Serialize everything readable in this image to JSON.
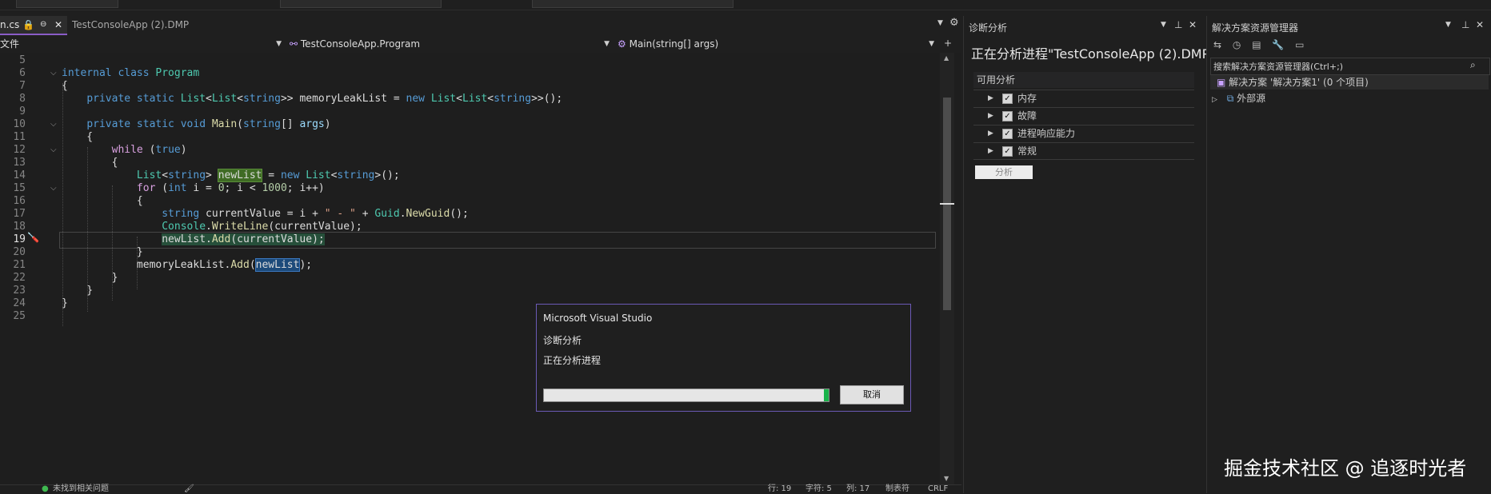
{
  "toolbar": {},
  "tabs": [
    {
      "label": "n.cs",
      "pin": "⊖",
      "close": "✕",
      "active": true
    },
    {
      "label": "TestConsoleApp (2).DMP",
      "active": false
    }
  ],
  "navbar": {
    "file_dropdown": "文件",
    "class_dropdown": "TestConsoleApp.Program",
    "member_dropdown": "Main(string[] args)"
  },
  "editor": {
    "lines": [
      {
        "n": "5"
      },
      {
        "n": "6"
      },
      {
        "n": "7"
      },
      {
        "n": "8"
      },
      {
        "n": "9"
      },
      {
        "n": "10"
      },
      {
        "n": "11"
      },
      {
        "n": "12"
      },
      {
        "n": "13"
      },
      {
        "n": "14"
      },
      {
        "n": "15"
      },
      {
        "n": "16"
      },
      {
        "n": "17"
      },
      {
        "n": "18"
      },
      {
        "n": "19"
      },
      {
        "n": "20"
      },
      {
        "n": "21"
      },
      {
        "n": "22"
      },
      {
        "n": "23"
      },
      {
        "n": "24"
      },
      {
        "n": "25"
      }
    ],
    "current_line": "19"
  },
  "status_bar": {
    "issues": "未找到相关问题",
    "line": "行: 19",
    "char": "字符: 5",
    "col": "列: 17",
    "tabs": "制表符",
    "eol": "CRLF"
  },
  "diagnostics": {
    "panel_title": "诊断分析",
    "heading": "正在分析进程\"TestConsoleApp (2).DMP\"",
    "available_label": "可用分析",
    "categories": [
      {
        "label": "内存",
        "checked": true
      },
      {
        "label": "故障",
        "checked": true
      },
      {
        "label": "进程响应能力",
        "checked": true
      },
      {
        "label": "常规",
        "checked": true
      }
    ],
    "analyze_button": "分析"
  },
  "solution_explorer": {
    "panel_title": "解决方案资源管理器",
    "search_placeholder": "搜索解决方案资源管理器(Ctrl+;)",
    "solution_item": "解决方案 '解决方案1' (0 个项目)",
    "external_sources": "外部源"
  },
  "dialog": {
    "title": "Microsoft Visual Studio",
    "subtitle": "诊断分析",
    "message": "正在分析进程",
    "progress": 0.99,
    "cancel": "取消",
    "border_color": "#6b59b5",
    "progress_color": "#19b34a"
  },
  "watermark": "掘金技术社区 @ 追逐时光者",
  "colors": {
    "keyword": "#569cd6",
    "type": "#4ec9b0",
    "string": "#d69d85",
    "accent": "#8a5cc7"
  },
  "icons": [
    "pin-icon",
    "close-icon",
    "gear-icon",
    "dropdown-caret-icon",
    "split-icon",
    "checkbox-icon",
    "expand-arrow-icon",
    "search-icon",
    "solution-icon",
    "external-sources-icon",
    "screwdriver-icon",
    "lightbulb-icon"
  ]
}
